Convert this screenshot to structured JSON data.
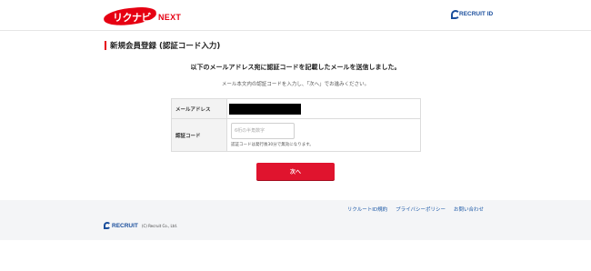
{
  "header": {
    "logo_text": "リクナビ",
    "logo_suffix": "NEXT",
    "recruit_id": "RECRUIT ID"
  },
  "page": {
    "title": "新規会員登録 (認証コード入力)",
    "lead": "以下のメールアドレス宛に認証コードを記載したメールを送信しました。",
    "sublead": "メール本文内の認証コードを入力し、「次へ」でお進みください。"
  },
  "form": {
    "email_label": "メールアドレス",
    "code_label": "認証コード",
    "code_placeholder": "6桁の半角数字",
    "code_value": "",
    "code_note": "認証コードは発行後30分で無効になります。"
  },
  "actions": {
    "next_label": "次へ"
  },
  "footer": {
    "links": [
      "リクルートID規約",
      "プライバシーポリシー",
      "お問い合わせ"
    ],
    "logo_text": "RECRUIT",
    "copyright": "(C) Recruit Co., Ltd."
  },
  "colors": {
    "brand_red": "#e60012",
    "button_red": "#e0142e",
    "link_blue": "#1a57a6",
    "recruit_blue": "#1a4e9c"
  }
}
